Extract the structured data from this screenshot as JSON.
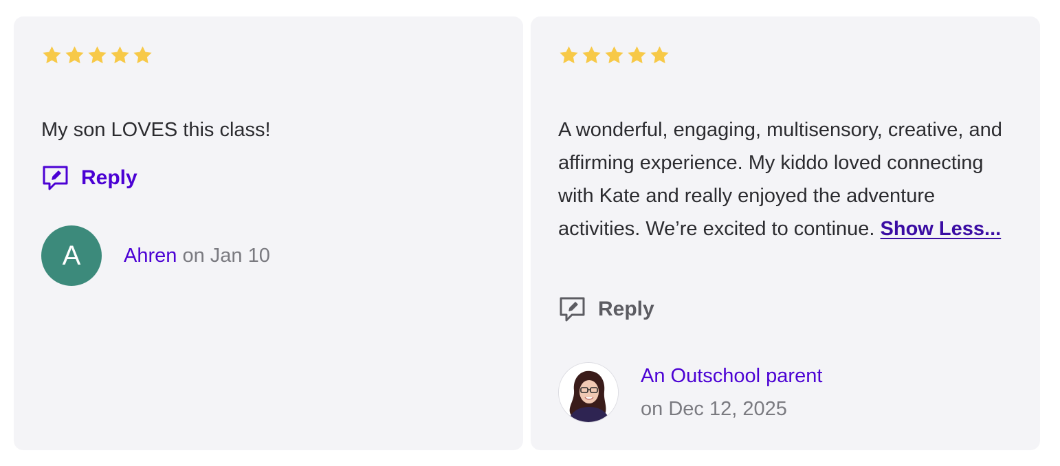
{
  "reviews": [
    {
      "rating": 5,
      "star_color": "#f7c948",
      "text": "My son LOVES this class!",
      "reply_label": "Reply",
      "reply_color": "#4b01d4",
      "author": {
        "avatar_type": "letter",
        "initial": "A",
        "avatar_color": "#3c8a7b",
        "name": "Ahren",
        "date": "on Jan 10"
      }
    },
    {
      "rating": 5,
      "star_color": "#f7c948",
      "text": "A wonderful, engaging, multisensory, creative, and affirming experience. My kiddo loved connecting with Kate and really enjoyed the adventure activities. We’re excited to continue. ",
      "show_less_label": "Show Less...",
      "reply_label": "Reply",
      "reply_color": "#5c5c62",
      "author": {
        "avatar_type": "photo",
        "name": "An Outschool parent",
        "date": "on Dec 12, 2025"
      }
    }
  ]
}
